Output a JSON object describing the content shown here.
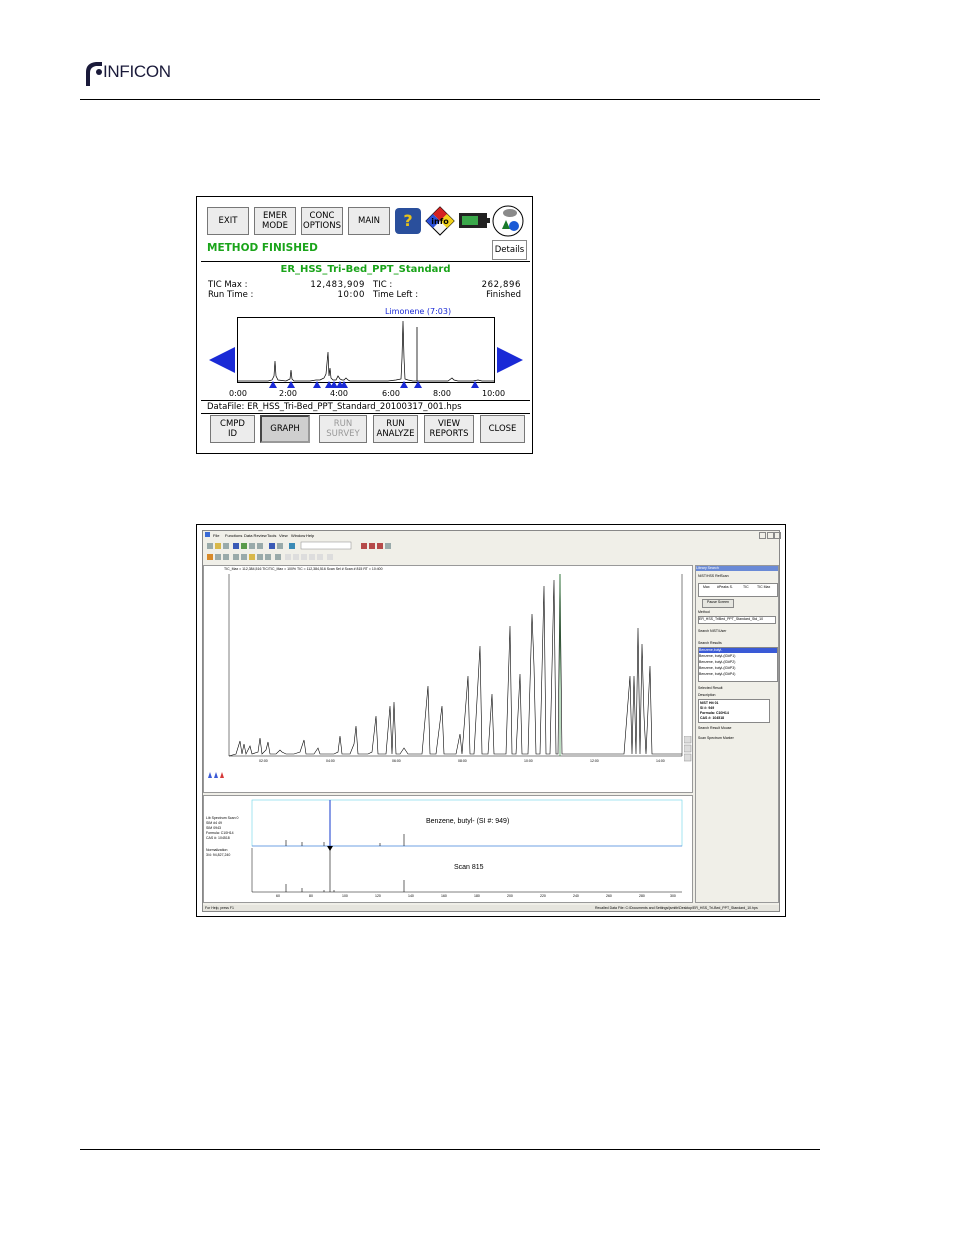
{
  "header": {
    "logo_text": "INFICON"
  },
  "instrument": {
    "toolbar": [
      "EXIT",
      "EMER\nMODE",
      "CONC\nOPTIONS",
      "MAIN"
    ],
    "help_icon": "help-icon",
    "info_icon": "info-icon",
    "status": "METHOD FINISHED",
    "details_label": "Details",
    "method_name": "ER_HSS_Tri-Bed_PPT_Standard",
    "tic_max_label": "TIC Max :",
    "tic_max_value": "12,483,909",
    "tic_label": "TIC :",
    "tic_value": "262,896",
    "run_time_label": "Run Time :",
    "run_time_value": "10:00",
    "time_left_label": "Time Left :",
    "time_left_value": "Finished",
    "peak_label": "Limonene (7:03)",
    "x_ticks": [
      "0:00",
      "2:00",
      "4:00",
      "6:00",
      "8:00",
      "10:00"
    ],
    "datafile": "DataFile: ER_HSS_Tri-Bed_PPT_Standard_20100317_001.hps",
    "bottom_buttons": [
      "CMPD\nID",
      "GRAPH",
      "RUN\nSURVEY",
      "RUN\nANALYZE",
      "VIEW\nREPORTS",
      "CLOSE"
    ],
    "colors": {
      "status_green": "#1aa41a",
      "arrow_blue": "#1a2ad6"
    }
  },
  "desktop": {
    "menu": [
      "File",
      "Functions",
      "Data Review",
      "Tools",
      "View",
      "Window",
      "Help"
    ],
    "chart_header": "TIC_Max = 112,384,516   TIC/TIC_Max = 100%   TIC = 112,384,516   Scan Sel #    Scan #    815   RT = 10:400",
    "tic_xticks": [
      "02:00",
      "04:00",
      "06:00",
      "08:00",
      "10:00",
      "12:00",
      "14:00"
    ],
    "spectrum_side": [
      "Lib Spectrum Scan 0",
      "SIM #4 49",
      "SIM 0943",
      "Formula: C10H14",
      "CAS #: 104518",
      "Normalization",
      "3/4: 94,827,240"
    ],
    "library_title": "Benzene, butyl- (SI #: 949)",
    "scan_title": "Scan 815",
    "mass_ticks": [
      "40",
      "60",
      "80",
      "100",
      "120",
      "140",
      "160",
      "180",
      "200",
      "220",
      "240",
      "260",
      "280",
      "300"
    ],
    "side_panel": {
      "title": "Library Search",
      "source": "NIST/HSS RefScan",
      "columns": [
        "Max",
        "#Peaks S.",
        "TIC",
        "TIC Max"
      ],
      "pause_button": "Pause Screen",
      "method_label": "Method",
      "method_value": "ER_HSS_TriBed_PPT_Standard_Std_10",
      "search_nist": "Search NIST/User",
      "results_label": "Search Results",
      "results": [
        "Benzene,butyl-",
        "Benzene, butyl-(ID#P1)",
        "Benzene, butyl-(ID#P2)",
        "Benzene, butyl-(ID#P3)",
        "Benzene, butyl-(ID#P4)"
      ],
      "selected_result": "Selected Result",
      "description": "Description",
      "desc_lines": [
        "NIST Hit 01",
        "SI #: 949",
        "Formula: C10H14",
        "CAS #: 104518"
      ],
      "search_mouse": "Search Result Mouse",
      "scan_spectrum": "Scan Spectrum Marker"
    },
    "status_left": "For Help, press F1",
    "status_right": "Recalled Data File: C:\\Documents and Settings\\jsmith\\Desktop\\ER_HSS_Tri-Bed_PPT_Standard_10.hps"
  }
}
